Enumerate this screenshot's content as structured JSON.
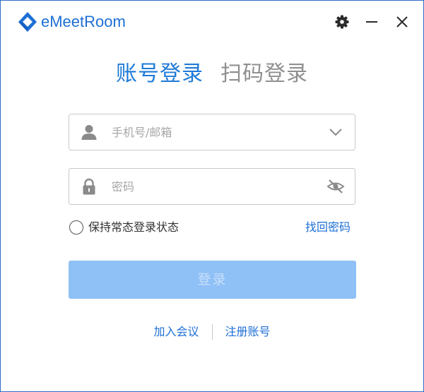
{
  "app": {
    "name": "eMeetRoom"
  },
  "titlebar": {
    "icons": [
      "settings-gear-icon",
      "minimize-icon",
      "close-icon"
    ]
  },
  "tabs": [
    {
      "label": "账号登录",
      "active": true
    },
    {
      "label": "扫码登录",
      "active": false
    }
  ],
  "form": {
    "account": {
      "placeholder": "手机号/邮箱",
      "value": "",
      "left_icon": "user-icon",
      "right_icon": "chevron-down-icon"
    },
    "password": {
      "placeholder": "密码",
      "value": "",
      "left_icon": "lock-icon",
      "right_icon": "eye-slash-icon"
    },
    "remember_label": "保持常态登录状态",
    "remember_checked": false,
    "forgot_label": "找回密码",
    "login_label": "登录"
  },
  "footer": {
    "join_label": "加入会议",
    "register_label": "注册账号"
  },
  "colors": {
    "accent": "#1d6fd6",
    "tab_active": "#1e7ad8",
    "tab_inactive": "#8f8f8f",
    "login_button_disabled": "#8fc0f6",
    "desktop_background": "#3d7bd1"
  }
}
